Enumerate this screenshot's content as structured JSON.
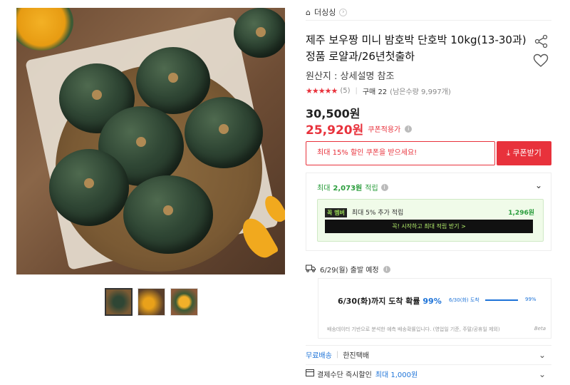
{
  "store": {
    "name": "더싱싱",
    "chevron": "›"
  },
  "product": {
    "title": "제주 보우짱 미니 밤호박 단호박 10kg(13-30과) 정품 로얄과/26년첫출하",
    "origin": "원산지 : 상세설명 참조",
    "stars": "★★★★★",
    "rating_count": "(5)",
    "purchase": "구매 22",
    "remaining": "(남은수량 9,997개)",
    "price": "30,500원",
    "sale_price": "25,920원",
    "coupon_applied": "쿠폰적용가"
  },
  "icons": {
    "share": "share-icon",
    "heart": "heart-icon",
    "info": "info-icon",
    "truck": "truck-icon",
    "card": "card-icon",
    "download": "download-icon"
  },
  "coupon": {
    "banner": "최대 15% 할인 쿠폰을 받으세요!",
    "button": "⤓ 쿠폰받기"
  },
  "points": {
    "header_prefix": "최대",
    "header_amount": "2,073원",
    "header_suffix": "적립",
    "member_badge": "꼭 멤버",
    "member_text": "최대 5% 추가 적립",
    "member_amount": "1,296원",
    "member_cta": "꼭! 시작하고 최대 적립 받기 >"
  },
  "shipping": {
    "dispatch": "6/29(월) 출발 예정",
    "arrival_prefix": "6/30(화)까지 도착 확률",
    "arrival_pct": "99%",
    "bar_label": "6/30(화) 도착",
    "bar_pct": "99%",
    "bar_fill": 0.99,
    "note": "배송데이터 기반으로 분석한 예측 배송확률입니다. (영업일 기준, 주말/공휴일 제외)",
    "beta": "Beta"
  },
  "rows": {
    "free_shipping": "무료배송",
    "carrier": "한진택배",
    "payment": "결제수단 즉시할인",
    "payment_max": "최대 1,000원"
  },
  "colors": {
    "accent": "#e8323c",
    "green": "#2a9d3c",
    "blue": "#1d73d8"
  }
}
